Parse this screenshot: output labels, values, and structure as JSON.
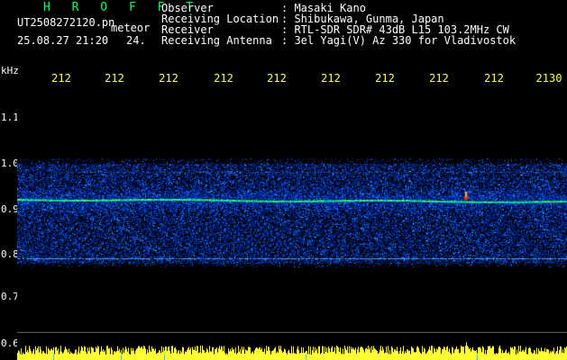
{
  "header": {
    "brand": "H R O F F T",
    "filename": "UT2508272120.pn",
    "tag": "meteor",
    "datetime": "25.08.27 21:20",
    "count": "24.",
    "info": {
      "observer_label": "Observer",
      "observer_value": ": Masaki Kano",
      "location_label": "Receiving Location",
      "location_value": ": Shibukawa, Gunma, Japan",
      "receiver_label": "Receiver",
      "receiver_value": ": RTL-SDR SDR# 43dB L15 103.2MHz CW",
      "antenna_label": "Receiving Antenna",
      "antenna_value": ": 3el Yagi(V) Az 330 for Vladivostok"
    }
  },
  "axes": {
    "y_unit": "kHz",
    "y_ticks": [
      "1.1",
      "1.0",
      "0.9",
      "0.8",
      "0.7",
      "0.6"
    ],
    "x_ticks": [
      "212",
      "212",
      "212",
      "212",
      "212",
      "212",
      "212",
      "212",
      "212",
      "2130"
    ]
  },
  "colors": {
    "brand": "#00ff66",
    "x_labels": "#ffff55",
    "noise_low": "#001030",
    "noise_mid": "#0050ff",
    "signal": "#00ff88",
    "amplitude": "#ffff33"
  },
  "chart_data": {
    "type": "heatmap",
    "y_unit": "kHz",
    "y_range": [
      0.6,
      1.15
    ],
    "x_tick_labels": [
      "212",
      "212",
      "212",
      "212",
      "212",
      "212",
      "212",
      "212",
      "212",
      "2130"
    ],
    "signal_line_khz": 0.92,
    "secondary_line_khz": 0.79,
    "spread_khz": [
      0.78,
      1.0
    ],
    "meteor_spike": {
      "label": "meteor"
    }
  }
}
